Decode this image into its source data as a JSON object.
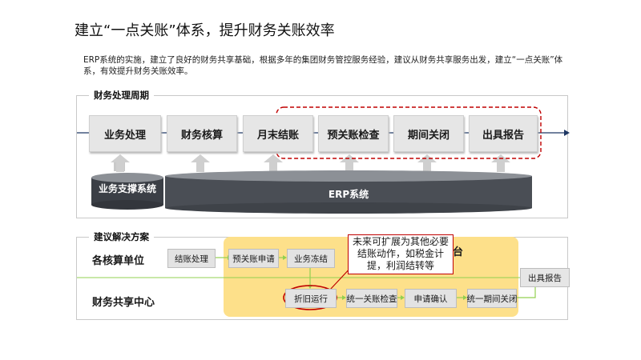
{
  "title": "建立“一点关账”体系，提升财务关账效率",
  "intro": "ERP系统的实施，建立了良好的财务共享基础，根据多年的集团财务管控服务经验，建议从财务共享服务出发，建立“一点关账”体系，有效提升财务关账效率。",
  "cycle": {
    "label": "财务处理周期",
    "steps": [
      "业务处理",
      "财务核算",
      "月末结账",
      "预关账检查",
      "期间关闭",
      "出具报告"
    ],
    "support_label": "业务支撑系统",
    "erp_label": "ERP系统"
  },
  "solution": {
    "label": "建议解决方案",
    "row1_label": "各核算单位",
    "row2_label": "财务共享中心",
    "platform_label_fragment": "台",
    "row1_boxes": [
      "结账处理",
      "预关账申请",
      "业务冻结"
    ],
    "row2_boxes": [
      "折旧运行",
      "统一关账检查",
      "申请确认",
      "统一期间关闭"
    ],
    "report_box": "出具报告",
    "callout": "未来可扩展为其他必要结账动作，如税金计提，利润结转等"
  },
  "colors": {
    "accent_red": "#c00000",
    "navy_arrow": "#1f3864",
    "platform_yellow": "#fde08a",
    "dark_cylinder": "#4a4e55",
    "connector_green": "#92d050"
  }
}
